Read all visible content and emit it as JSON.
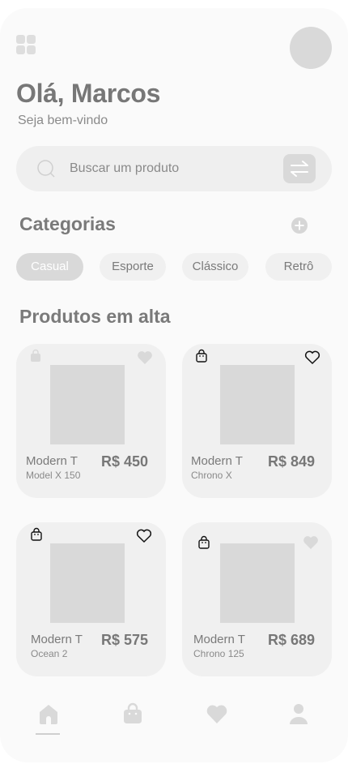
{
  "header": {
    "menu_icon": "grid-menu-icon",
    "avatar_icon": "avatar",
    "greeting": "Olá, Marcos",
    "subgreeting": "Seja bem-vindo"
  },
  "search": {
    "placeholder": "Buscar um produto",
    "icon": "search-icon",
    "filter_icon": "swap-arrows-icon"
  },
  "categories": {
    "title": "Categorias",
    "add_icon": "plus-icon",
    "items": [
      {
        "label": "Casual",
        "active": true
      },
      {
        "label": "Esporte",
        "active": false
      },
      {
        "label": "Clássico",
        "active": false
      },
      {
        "label": "Retrô",
        "active": false
      }
    ]
  },
  "products": {
    "title": "Produtos em alta",
    "items": [
      {
        "name": "Modern T",
        "model": "Model X 150",
        "price": "R$ 450",
        "bag_icon": "bag-icon",
        "heart_icon": "heart-icon",
        "favorited": true
      },
      {
        "name": "Modern T",
        "model": "Chrono X",
        "price": "R$ 849",
        "bag_icon": "bag-icon",
        "heart_icon": "heart-icon",
        "favorited": false
      },
      {
        "name": "Modern T",
        "model": "Ocean 2",
        "price": "R$ 575",
        "bag_icon": "bag-icon",
        "heart_icon": "heart-icon",
        "favorited": false
      },
      {
        "name": "Modern T",
        "model": "Chrono 125",
        "price": "R$ 689",
        "bag_icon": "bag-icon",
        "heart_icon": "heart-icon",
        "favorited": true
      }
    ]
  },
  "bottom_nav": {
    "items": [
      {
        "icon": "home-icon",
        "active": true
      },
      {
        "icon": "bag-icon",
        "active": false
      },
      {
        "icon": "heart-icon",
        "active": false
      },
      {
        "icon": "user-icon",
        "active": false
      }
    ]
  },
  "colors": {
    "background": "#fafafa",
    "surface": "#f0f0f0",
    "placeholder": "#d9d9d9",
    "text": "#7a7a7a"
  }
}
